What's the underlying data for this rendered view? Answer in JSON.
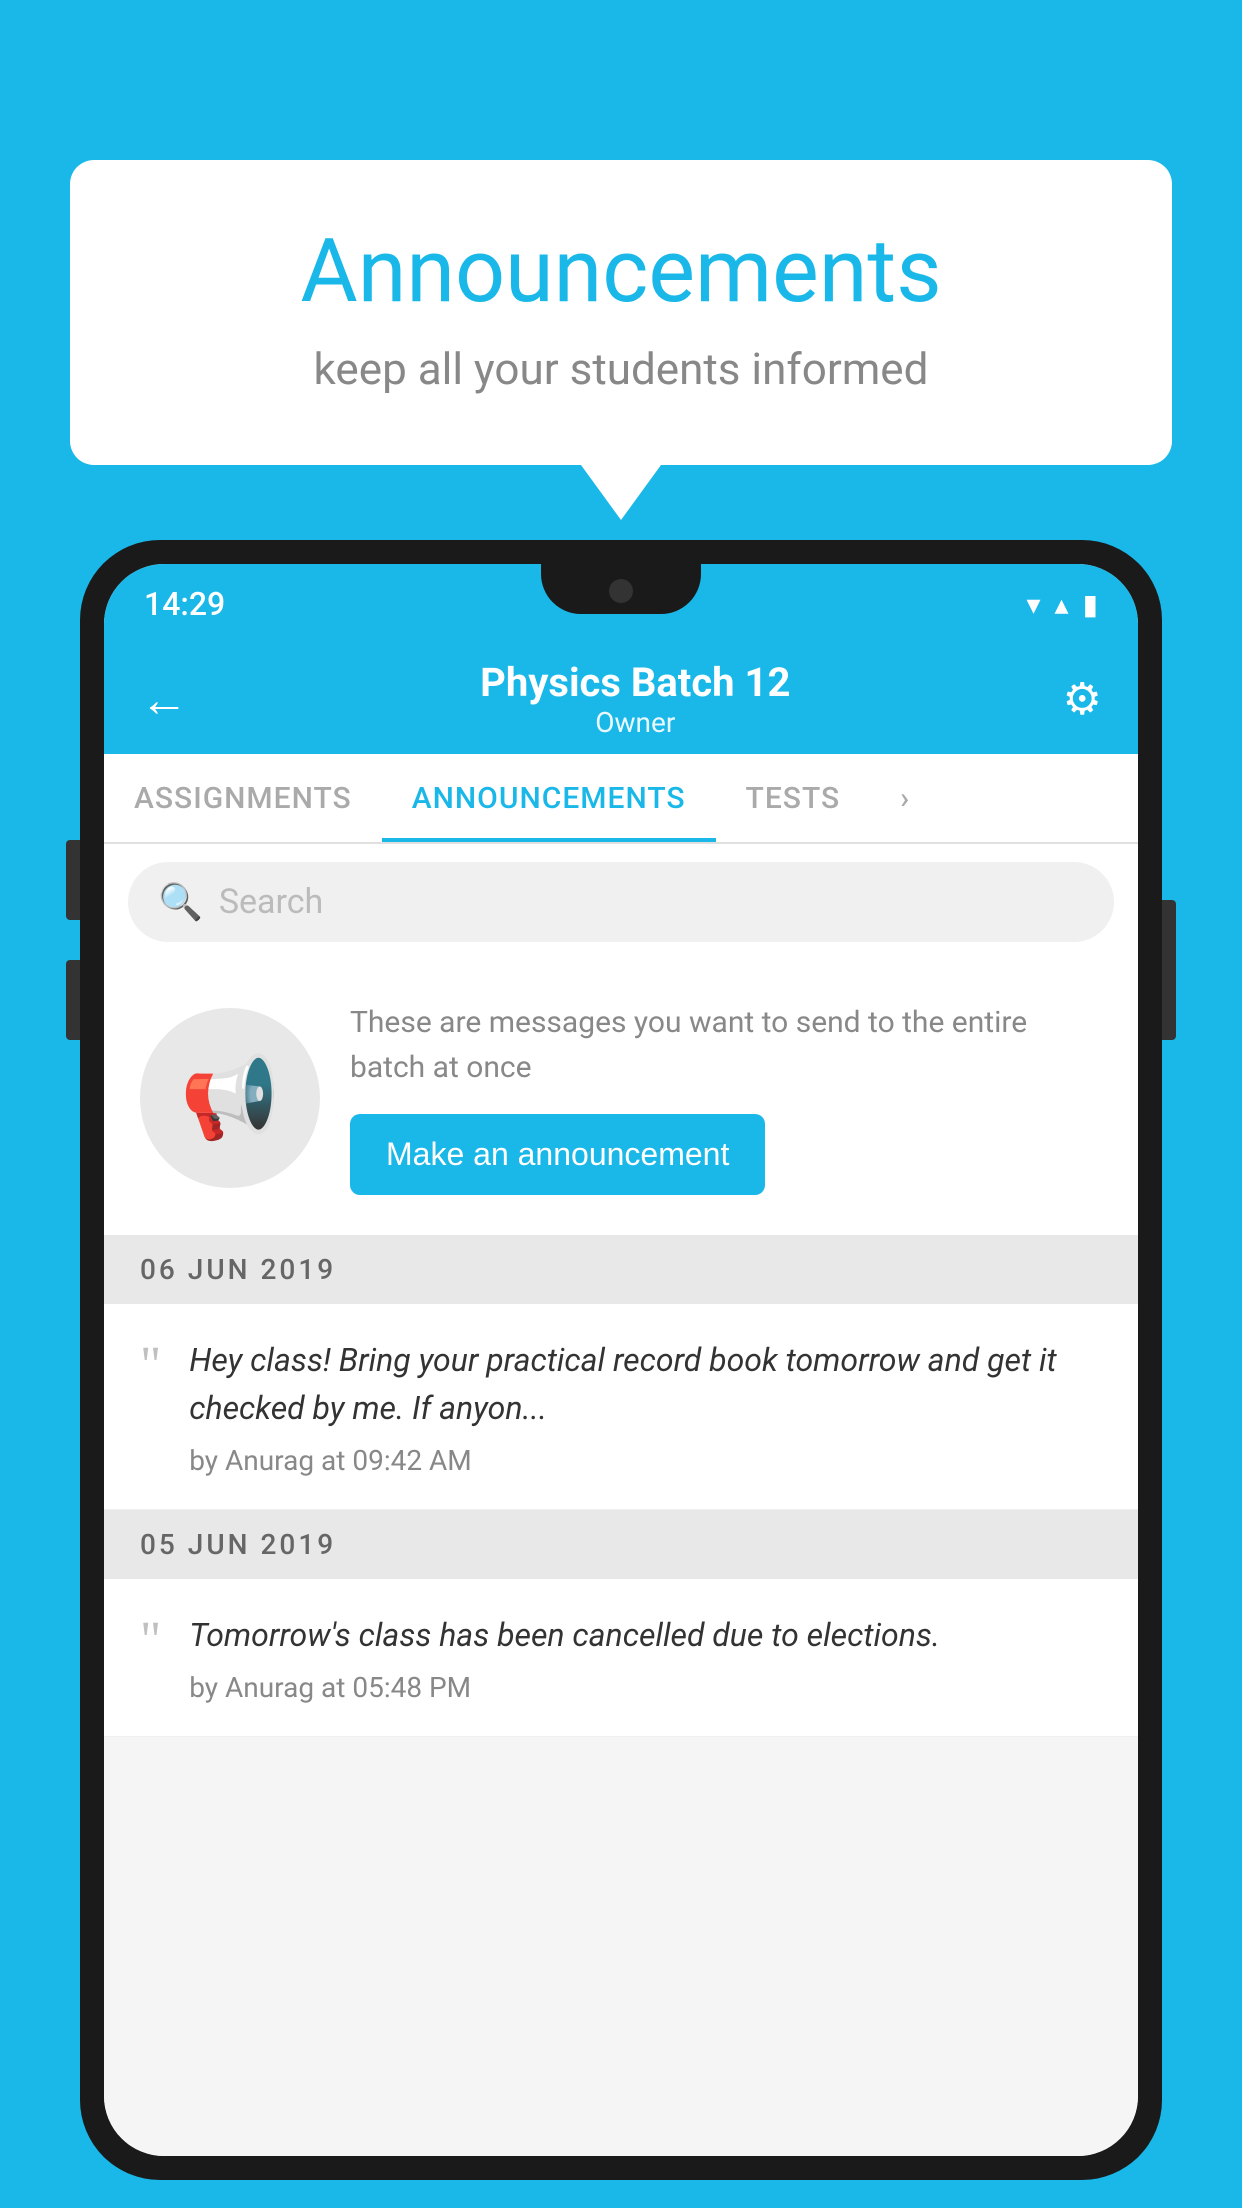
{
  "page": {
    "background_color": "#1ab8e8"
  },
  "speech_bubble": {
    "title": "Announcements",
    "subtitle": "keep all your students informed"
  },
  "phone": {
    "status_bar": {
      "time": "14:29",
      "wifi_icon": "▼",
      "signal_icon": "▲",
      "battery_icon": "▮"
    },
    "toolbar": {
      "back_icon": "←",
      "title": "Physics Batch 12",
      "subtitle": "Owner",
      "gear_icon": "⚙"
    },
    "tabs": [
      {
        "label": "ASSIGNMENTS",
        "active": false
      },
      {
        "label": "ANNOUNCEMENTS",
        "active": true
      },
      {
        "label": "TESTS",
        "active": false
      },
      {
        "label": "•",
        "active": false
      }
    ],
    "search": {
      "placeholder": "Search"
    },
    "promo": {
      "description": "These are messages you want to send to the entire batch at once",
      "button_label": "Make an announcement"
    },
    "announcements": [
      {
        "date": "06  JUN  2019",
        "text": "Hey class! Bring your practical record book tomorrow and get it checked by me. If anyon...",
        "author": "by Anurag at 09:42 AM"
      },
      {
        "date": "05  JUN  2019",
        "text": "Tomorrow's class has been cancelled due to elections.",
        "author": "by Anurag at 05:48 PM"
      }
    ]
  }
}
